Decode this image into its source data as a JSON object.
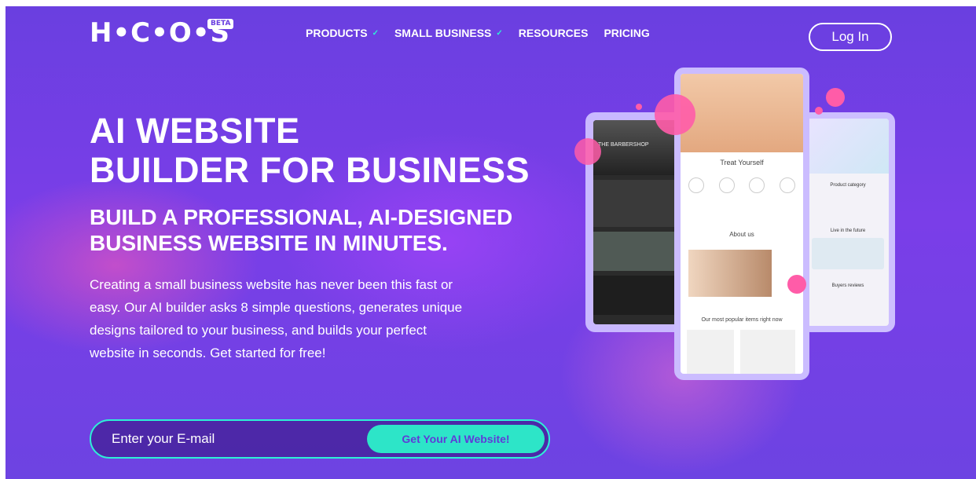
{
  "nav": {
    "logo": "H•C•O•S",
    "badge": "BETA",
    "items": [
      {
        "label": "PRODUCTS",
        "dropdown": true
      },
      {
        "label": "SMALL BUSINESS",
        "dropdown": true
      },
      {
        "label": "RESOURCES",
        "dropdown": false
      },
      {
        "label": "PRICING",
        "dropdown": false
      }
    ],
    "login_label": "Log In"
  },
  "hero": {
    "title_line1": "AI WEBSITE",
    "title_line2": "BUILDER FOR BUSINESS",
    "subtitle_line1": "BUILD A PROFESSIONAL, AI-DESIGNED",
    "subtitle_line2": "BUSINESS WEBSITE IN MINUTES.",
    "description": "Creating a small business website has never been this fast or easy. Our AI builder asks 8 simple questions, generates unique designs tailored to your business, and builds your perfect website in seconds. Get started for free!"
  },
  "signup": {
    "email_placeholder": "Enter your E-mail",
    "cta_label": "Get Your AI Website!"
  },
  "mockups": {
    "left_title": "THE BARBERSHOP",
    "center_section1": "Treat Yourself",
    "center_section2": "About us",
    "center_section3": "Our most popular items right now",
    "right_section1": "Product category",
    "right_section2": "Live in the future",
    "right_section3": "Buyers reviews"
  },
  "colors": {
    "background": "#6a3fe0",
    "accent": "#2de5c8",
    "pink": "#ff5ca8"
  }
}
